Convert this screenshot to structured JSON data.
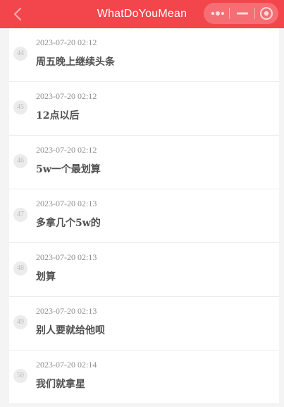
{
  "header": {
    "title": "WhatDoYouMean",
    "back_icon": "chevron-left-icon",
    "more_icon": "more-dots-icon",
    "minimize_icon": "minimize-icon",
    "close_icon": "target-circle-icon",
    "accent_color": "#f2464c"
  },
  "messages": [
    {
      "index": "44",
      "time": "2023-07-20 02:12",
      "text": "周五晚上继续头条"
    },
    {
      "index": "45",
      "time": "2023-07-20 02:12",
      "text": "12点以后"
    },
    {
      "index": "46",
      "time": "2023-07-20 02:12",
      "text": "5w一个最划算"
    },
    {
      "index": "47",
      "time": "2023-07-20 02:13",
      "text": "多拿几个5w的"
    },
    {
      "index": "48",
      "time": "2023-07-20 02:13",
      "text": "划算"
    },
    {
      "index": "49",
      "time": "2023-07-20 02:13",
      "text": "别人要就给他呗"
    },
    {
      "index": "50",
      "time": "2023-07-20 02:14",
      "text": "我们就拿星"
    }
  ]
}
